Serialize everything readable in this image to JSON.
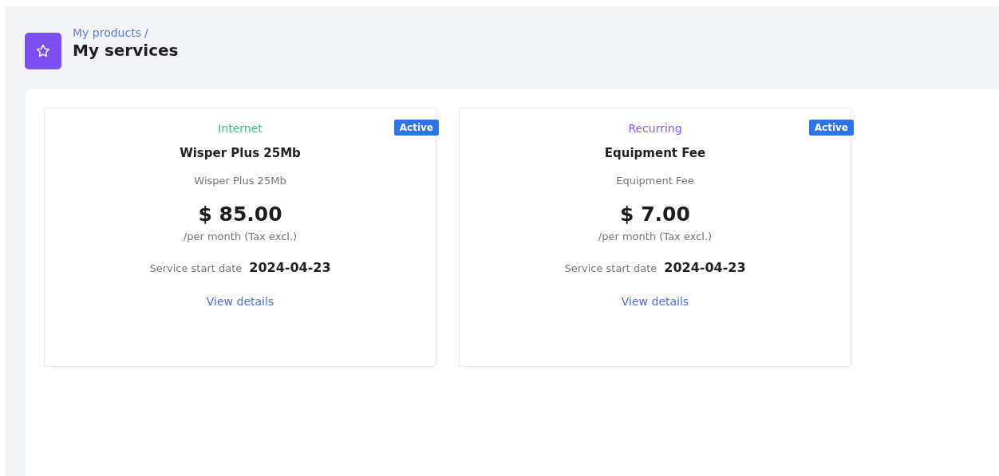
{
  "breadcrumb": {
    "parent": "My products",
    "separator": "/",
    "title": "My services"
  },
  "services": [
    {
      "category": "Internet",
      "color": "#3fbf7f",
      "status": "Active",
      "name": "Wisper Plus 25Mb",
      "description": "Wisper Plus 25Mb",
      "price": "$ 85.00",
      "period": "/per month (Tax excl.)",
      "start_label": "Service start date",
      "start_date": "2024-04-23",
      "link": "View details"
    },
    {
      "category": "Recurring",
      "color": "#8b5cf6",
      "status": "Active",
      "name": "Equipment Fee",
      "description": "Equipment Fee",
      "price": "$ 7.00",
      "period": "/per month (Tax excl.)",
      "start_label": "Service start date",
      "start_date": "2024-04-23",
      "link": "View details"
    }
  ]
}
